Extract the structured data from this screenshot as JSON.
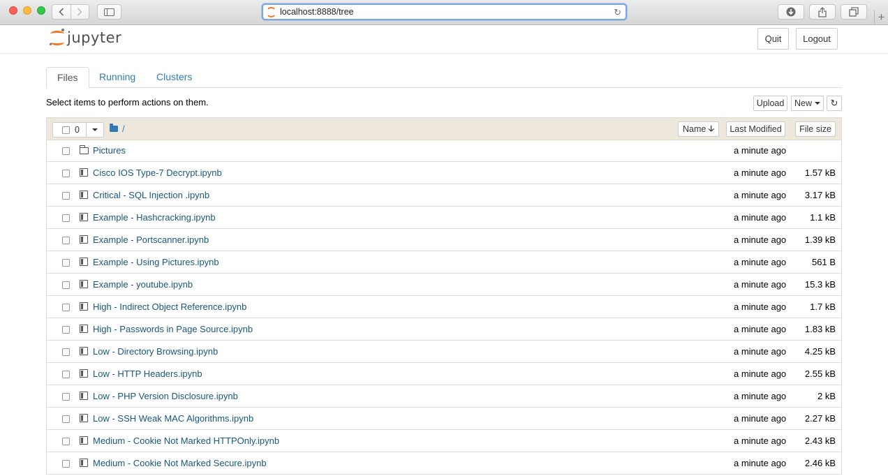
{
  "browser": {
    "url": "localhost:8888/tree",
    "icons": [
      "back-icon",
      "forward-icon",
      "sidebar-icon",
      "reload-icon",
      "download-icon",
      "share-icon",
      "tabs-icon",
      "new-tab-icon"
    ]
  },
  "header": {
    "logo_text": "jupyter",
    "quit_label": "Quit",
    "logout_label": "Logout"
  },
  "tabs": [
    {
      "label": "Files",
      "active": true
    },
    {
      "label": "Running",
      "active": false
    },
    {
      "label": "Clusters",
      "active": false
    }
  ],
  "toolbar": {
    "instructions": "Select items to perform actions on them.",
    "upload_label": "Upload",
    "new_label": "New",
    "refresh_icon": "refresh-icon"
  },
  "listing": {
    "selected_count": "0",
    "breadcrumb": "/",
    "sort_name_label": "Name",
    "sort_modified_label": "Last Modified",
    "sort_size_label": "File size",
    "items": [
      {
        "type": "directory",
        "name": "Pictures",
        "modified": "a minute ago",
        "size": ""
      },
      {
        "type": "notebook",
        "name": "Cisco IOS Type-7 Decrypt.ipynb",
        "modified": "a minute ago",
        "size": "1.57 kB"
      },
      {
        "type": "notebook",
        "name": "Critical - SQL Injection .ipynb",
        "modified": "a minute ago",
        "size": "3.17 kB"
      },
      {
        "type": "notebook",
        "name": "Example - Hashcracking.ipynb",
        "modified": "a minute ago",
        "size": "1.1 kB"
      },
      {
        "type": "notebook",
        "name": "Example - Portscanner.ipynb",
        "modified": "a minute ago",
        "size": "1.39 kB"
      },
      {
        "type": "notebook",
        "name": "Example - Using Pictures.ipynb",
        "modified": "a minute ago",
        "size": "561 B"
      },
      {
        "type": "notebook",
        "name": "Example - youtube.ipynb",
        "modified": "a minute ago",
        "size": "15.3 kB"
      },
      {
        "type": "notebook",
        "name": "High - Indirect Object Reference.ipynb",
        "modified": "a minute ago",
        "size": "1.7 kB"
      },
      {
        "type": "notebook",
        "name": "High - Passwords in Page Source.ipynb",
        "modified": "a minute ago",
        "size": "1.83 kB"
      },
      {
        "type": "notebook",
        "name": "Low - Directory Browsing.ipynb",
        "modified": "a minute ago",
        "size": "4.25 kB"
      },
      {
        "type": "notebook",
        "name": "Low - HTTP Headers.ipynb",
        "modified": "a minute ago",
        "size": "2.55 kB"
      },
      {
        "type": "notebook",
        "name": "Low - PHP Version Disclosure.ipynb",
        "modified": "a minute ago",
        "size": "2 kB"
      },
      {
        "type": "notebook",
        "name": "Low - SSH Weak MAC Algorithms.ipynb",
        "modified": "a minute ago",
        "size": "2.27 kB"
      },
      {
        "type": "notebook",
        "name": "Medium - Cookie Not Marked HTTPOnly.ipynb",
        "modified": "a minute ago",
        "size": "2.43 kB"
      },
      {
        "type": "notebook",
        "name": "Medium - Cookie Not Marked Secure.ipynb",
        "modified": "a minute ago",
        "size": "2.46 kB"
      }
    ]
  }
}
